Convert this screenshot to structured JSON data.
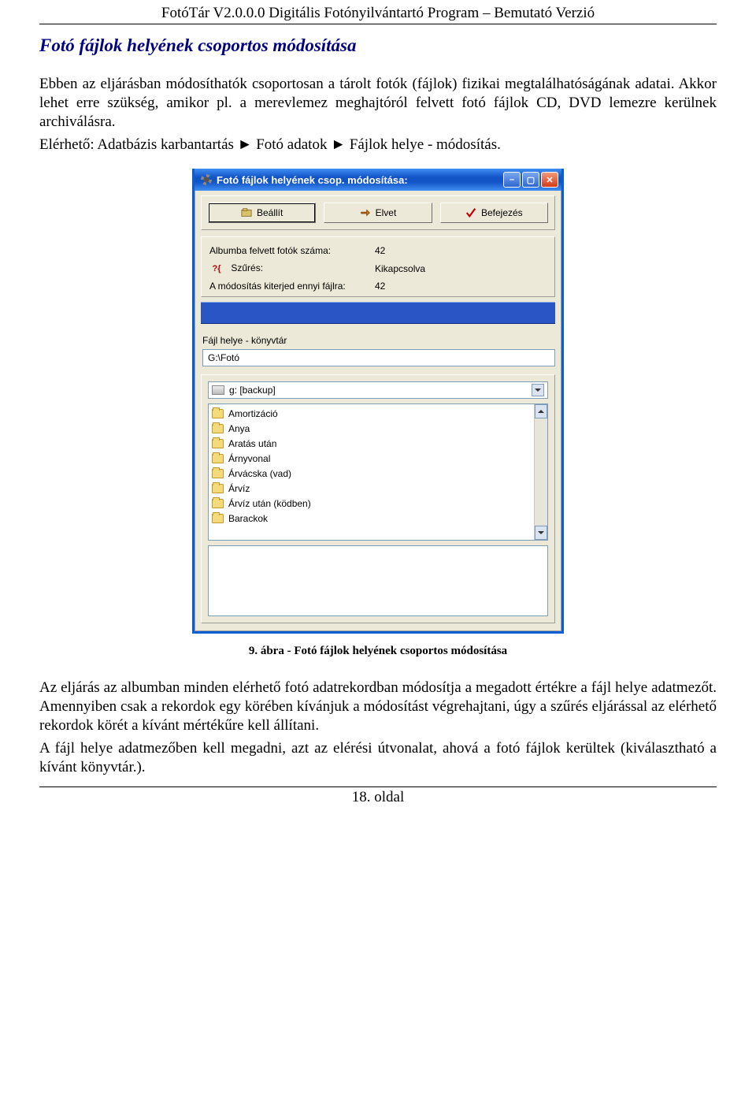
{
  "header": "FotóTár V2.0.0.0 Digitális Fotónyilvántartó Program – Bemutató Verzió",
  "section_title": "Fotó fájlok helyének csoportos módosítása",
  "intro_p1": "Ebben az eljárásban módosíthatók csoportosan a tárolt fotók (fájlok) fizikai megtalálhatóságának adatai. Akkor lehet erre szükség, amikor pl. a merevlemez meghajtóról felvett fotó fájlok CD, DVD lemezre kerülnek archiválásra.",
  "intro_p2": "Elérhető: Adatbázis karbantartás ► Fotó adatok ► Fájlok helye - módosítás.",
  "caption": "9. ábra - Fotó fájlok helyének csoportos módosítása",
  "outro_p1": "Az eljárás az albumban minden elérhető fotó adatrekordban módosítja a megadott értékre a fájl helye adatmezőt. Amennyiben csak a rekordok egy körében kívánjuk a módosítást végrehajtani, úgy a szűrés eljárással az elérhető rekordok körét a kívánt mértékűre kell állítani.",
  "outro_p2": "A fájl helye adatmezőben kell megadni, azt az elérési útvonalat, ahová a fotó fájlok kerültek (kiválasztható a kívánt könyvtár.).",
  "page_number": "18. oldal",
  "window": {
    "title": "Fotó fájlok helyének csop. módosítása:",
    "buttons": {
      "set": "Beállít",
      "discard": "Elvet",
      "finish": "Befejezés"
    },
    "info": {
      "count_label": "Albumba felvett fotók száma:",
      "count_value": "42",
      "filter_label": "Szűrés:",
      "filter_value": "Kikapcsolva",
      "mod_label": "A módosítás kiterjed ennyi fájlra:",
      "mod_value": "42"
    },
    "path_label": "Fájl helye - könyvtár",
    "path_value": "G:\\Fotó",
    "drive": "g: [backup]",
    "folders": [
      "Amortizáció",
      "Anya",
      "Aratás után",
      "Árnyvonal",
      "Árvácska (vad)",
      "Árvíz",
      "Árvíz után (ködben)",
      "Barackok"
    ]
  }
}
